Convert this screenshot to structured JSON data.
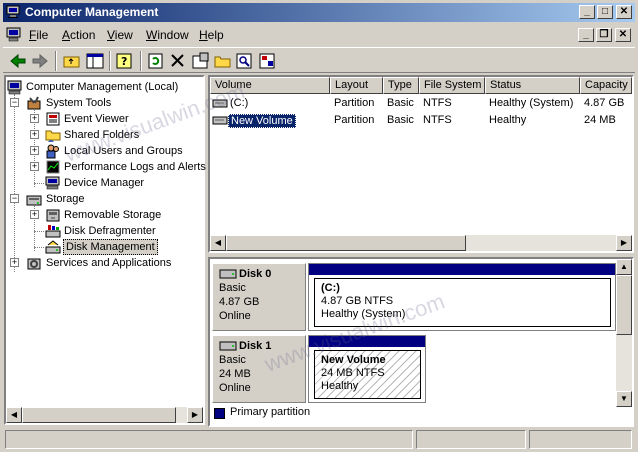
{
  "window": {
    "title": "Computer Management"
  },
  "menu": {
    "items": [
      {
        "label": "File",
        "accel": "F"
      },
      {
        "label": "Action",
        "accel": "A"
      },
      {
        "label": "View",
        "accel": "V"
      },
      {
        "label": "Window",
        "accel": "W"
      },
      {
        "label": "Help",
        "accel": "H"
      }
    ]
  },
  "toolbar": {
    "buttons": [
      "back-icon",
      "forward-icon",
      "up-folder-icon",
      "show-hide-tree-icon",
      "help-icon",
      "refresh-icon",
      "delete-icon",
      "properties-icon",
      "open-folder-icon",
      "search-icon",
      "export-icon"
    ]
  },
  "tree": {
    "root": "Computer Management (Local)",
    "system_tools": "System Tools",
    "event_viewer": "Event Viewer",
    "shared_folders": "Shared Folders",
    "local_users": "Local Users and Groups",
    "perf_logs": "Performance Logs and Alerts",
    "device_manager": "Device Manager",
    "storage": "Storage",
    "removable_storage": "Removable Storage",
    "disk_defrag": "Disk Defragmenter",
    "disk_management": "Disk Management",
    "services_apps": "Services and Applications"
  },
  "volumes": {
    "headers": [
      "Volume",
      "Layout",
      "Type",
      "File System",
      "Status",
      "Capacity"
    ],
    "rows": [
      {
        "volume": "(C:)",
        "layout": "Partition",
        "type": "Basic",
        "fs": "NTFS",
        "status": "Healthy (System)",
        "capacity": "4.87 GB"
      },
      {
        "volume": "New Volume",
        "layout": "Partition",
        "type": "Basic",
        "fs": "NTFS",
        "status": "Healthy",
        "capacity": "24 MB"
      }
    ]
  },
  "disks": [
    {
      "name": "Disk 0",
      "type": "Basic",
      "size": "4.87 GB",
      "state": "Online",
      "partition": {
        "name": "(C:)",
        "info": "4.87 GB NTFS",
        "status": "Healthy (System)"
      }
    },
    {
      "name": "Disk 1",
      "type": "Basic",
      "size": "24 MB",
      "state": "Online",
      "partition": {
        "name": "New Volume",
        "info": "24 MB NTFS",
        "status": "Healthy"
      }
    }
  ],
  "legend": {
    "label": "Primary partition",
    "color": "#000080"
  },
  "watermark": {
    "text1": "www.visualwin.com",
    "text2": "www.visualwin.com"
  },
  "colors": {
    "title_start": "#0a246a",
    "title_end": "#a6caf0",
    "partition_header": "#000080",
    "selection": "#0a246a"
  }
}
